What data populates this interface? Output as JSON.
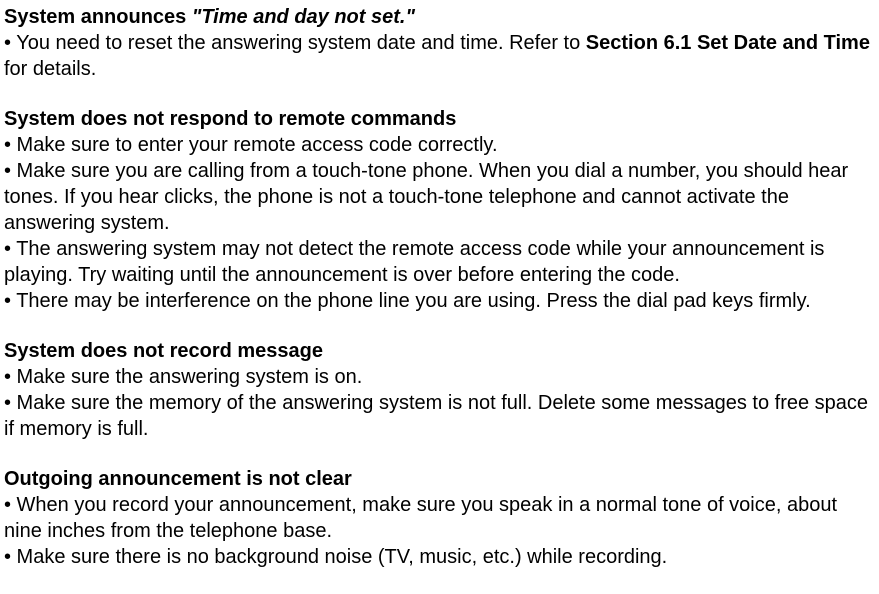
{
  "sections": [
    {
      "heading_prefix": "System announces ",
      "heading_quoted": "\"Time and day not set.\"",
      "bullets": [
        {
          "pre": "• You need to reset the answering system date and time. Refer to ",
          "bold": "Section 6.1 Set Date and Time",
          "post": " for details."
        }
      ]
    },
    {
      "heading_prefix": " System does not respond to remote commands",
      "bullets": [
        {
          "pre": "• Make sure to enter your remote access code correctly."
        },
        {
          "pre": "• Make sure you are calling from a touch-tone phone. When you dial a number, you should hear tones. If you hear clicks, the phone is not a touch-tone telephone and cannot activate the answering system."
        },
        {
          "pre": "• The answering system may not detect the remote access code while your announcement is playing. Try waiting until the announcement is over before entering the code."
        },
        {
          "pre": "• There may be interference on the phone line you are using. Press the dial pad keys firmly."
        }
      ]
    },
    {
      "heading_prefix": "System does not record message",
      "bullets": [
        {
          "pre": "• Make sure the answering system is on."
        },
        {
          "pre": "• Make sure the memory of the answering system is not full. Delete some messages to free space if memory is full."
        }
      ]
    },
    {
      "heading_prefix": "Outgoing announcement is not clear",
      "bullets": [
        {
          "pre": "• When you record your announcement, make sure you speak in a normal tone of voice, about nine inches from the telephone base."
        },
        {
          "pre": "• Make sure there is no background noise (TV, music, etc.) while recording."
        }
      ]
    }
  ]
}
